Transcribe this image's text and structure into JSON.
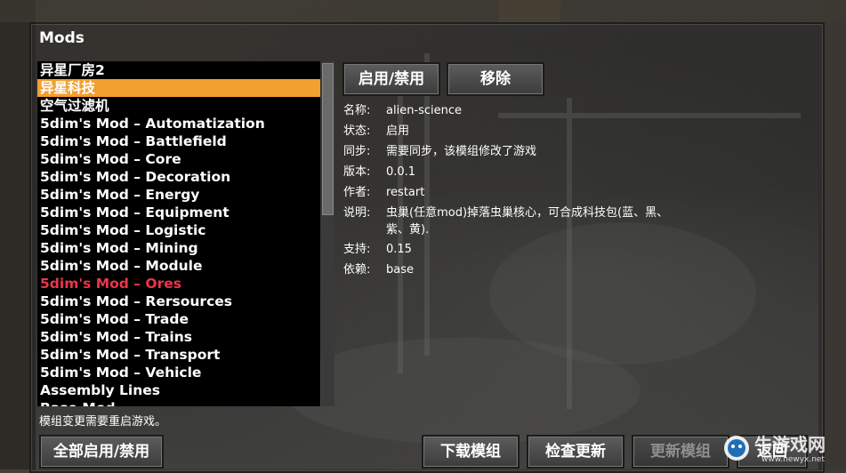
{
  "window": {
    "title": "Mods"
  },
  "mods_list": {
    "items": [
      {
        "label": "异星厂房2",
        "state": "normal"
      },
      {
        "label": "异星科技",
        "state": "selected"
      },
      {
        "label": "空气过滤机",
        "state": "normal"
      },
      {
        "label": "5dim's Mod – Automatization",
        "state": "normal"
      },
      {
        "label": "5dim's Mod – Battlefield",
        "state": "normal"
      },
      {
        "label": "5dim's Mod – Core",
        "state": "normal"
      },
      {
        "label": "5dim's Mod – Decoration",
        "state": "normal"
      },
      {
        "label": "5dim's Mod – Energy",
        "state": "normal"
      },
      {
        "label": "5dim's Mod – Equipment",
        "state": "normal"
      },
      {
        "label": "5dim's Mod – Logistic",
        "state": "normal"
      },
      {
        "label": "5dim's Mod – Mining",
        "state": "normal"
      },
      {
        "label": "5dim's Mod – Module",
        "state": "normal"
      },
      {
        "label": "5dim's Mod – Ores",
        "state": "disabled"
      },
      {
        "label": "5dim's Mod – Rersources",
        "state": "normal"
      },
      {
        "label": "5dim's Mod – Trade",
        "state": "normal"
      },
      {
        "label": "5dim's Mod – Trains",
        "state": "normal"
      },
      {
        "label": "5dim's Mod – Transport",
        "state": "normal"
      },
      {
        "label": "5dim's Mod – Vehicle",
        "state": "normal"
      },
      {
        "label": "Assembly Lines",
        "state": "normal"
      },
      {
        "label": "Base Mod",
        "state": "normal"
      }
    ]
  },
  "actions": {
    "enable_disable": "启用/禁用",
    "remove": "移除",
    "enable_disable_all": "全部启用/禁用",
    "download_mods": "下载模组",
    "check_updates": "检查更新",
    "update_mods": "更新模组",
    "back": "返回"
  },
  "details": {
    "name_key": "名称:",
    "name_val": "alien-science",
    "status_key": "状态:",
    "status_val": "启用",
    "sync_key": "同步:",
    "sync_val": "需要同步，该模组修改了游戏",
    "version_key": "版本:",
    "version_val": "0.0.1",
    "author_key": "作者:",
    "author_val": "restart",
    "desc_key": "说明:",
    "desc_line1": "虫巢(任意mod)掉落虫巢核心，可合成科技包(蓝、黑、",
    "desc_line2": "紫、黄).",
    "support_key": "支持:",
    "support_val": "0.15",
    "depends_key": "依赖:",
    "depends_val": "base"
  },
  "notice": "模组变更需要重启游戏。",
  "watermark": {
    "text": "牛游戏网",
    "url_text": "www.newyx.net"
  },
  "colors": {
    "selected": "#f2a030",
    "disabled_text": "#e8374a"
  }
}
